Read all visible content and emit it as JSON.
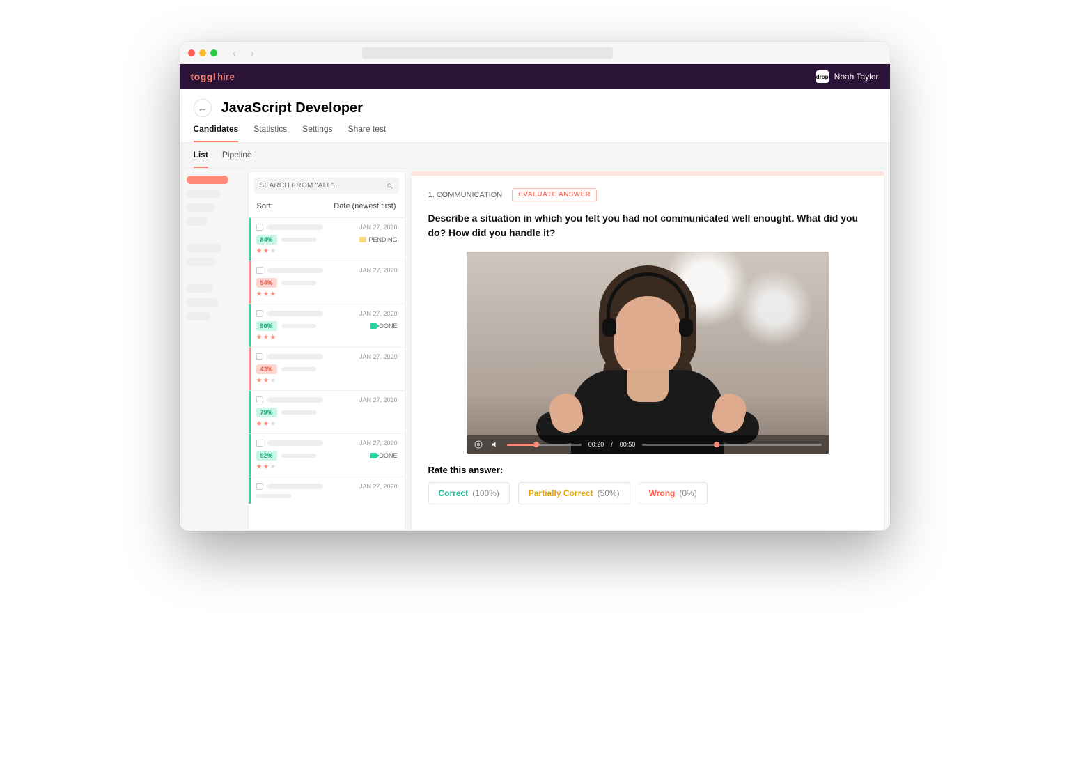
{
  "os_window": {
    "url_placeholder": ""
  },
  "brand": {
    "logo_primary": "toggl",
    "logo_secondary": "hire"
  },
  "user": {
    "avatar_label": "drop",
    "name": "Noah Taylor"
  },
  "page": {
    "title": "JavaScript Developer",
    "tabs": [
      "Candidates",
      "Statistics",
      "Settings",
      "Share test"
    ],
    "active_tab_index": 0,
    "subtabs": [
      "List",
      "Pipeline"
    ],
    "active_subtab_index": 0
  },
  "search": {
    "placeholder": "SEARCH FROM \"ALL\"..."
  },
  "sort": {
    "label": "Sort:",
    "value": "Date (newest first)"
  },
  "candidates": [
    {
      "date": "JAN 27, 2020",
      "score": "84%",
      "score_tone": "good",
      "status": "PENDING",
      "status_kind": "pending",
      "stars": 2,
      "edge": "green"
    },
    {
      "date": "JAN 27, 2020",
      "score": "54%",
      "score_tone": "bad",
      "status": "",
      "status_kind": "none",
      "stars": 3,
      "edge": "red"
    },
    {
      "date": "JAN 27, 2020",
      "score": "90%",
      "score_tone": "good",
      "status": "DONE",
      "status_kind": "video",
      "stars": 3,
      "edge": "green"
    },
    {
      "date": "JAN 27, 2020",
      "score": "43%",
      "score_tone": "bad",
      "status": "",
      "status_kind": "none",
      "stars": 2,
      "edge": "red"
    },
    {
      "date": "JAN 27, 2020",
      "score": "79%",
      "score_tone": "good",
      "status": "",
      "status_kind": "none",
      "stars": 2,
      "edge": "green"
    },
    {
      "date": "JAN 27, 2020",
      "score": "92%",
      "score_tone": "good",
      "status": "DONE",
      "status_kind": "video",
      "stars": 2,
      "edge": "green"
    },
    {
      "date": "JAN 27, 2020",
      "score": "",
      "score_tone": "good",
      "status": "",
      "status_kind": "none",
      "stars": 0,
      "edge": "green"
    }
  ],
  "detail": {
    "category_label": "1. COMMUNICATION",
    "badge": "EVALUATE ANSWER",
    "question": "Describe a situation in which you felt you had not communicated well enought. What did you do? How did you handle it?",
    "video": {
      "elapsed": "00:20",
      "total": "00:50",
      "fraction": 0.4
    },
    "rate_heading": "Rate this answer:",
    "rate_options": [
      {
        "label": "Correct",
        "pct": "(100%)",
        "tone": "correct"
      },
      {
        "label": "Partially Correct",
        "pct": "(50%)",
        "tone": "partial"
      },
      {
        "label": "Wrong",
        "pct": "(0%)",
        "tone": "wrong"
      }
    ]
  }
}
